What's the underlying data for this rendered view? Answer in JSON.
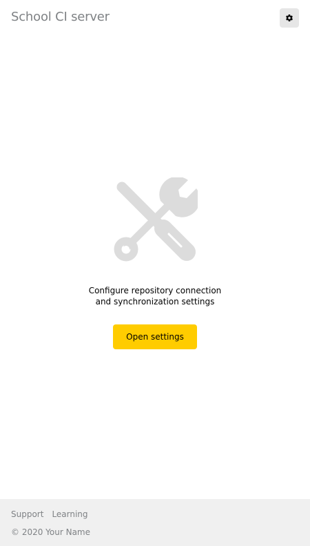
{
  "header": {
    "title": "School CI server",
    "settings_icon": "gear-icon"
  },
  "main": {
    "illustration_icon": "tools-icon",
    "message_line1": "Configure repository connection",
    "message_line2": "and synchronization settings",
    "button_label": "Open settings"
  },
  "footer": {
    "links": [
      {
        "label": "Support"
      },
      {
        "label": "Learning"
      }
    ],
    "copyright": "© 2020 Your Name"
  },
  "colors": {
    "accent": "#ffcc00",
    "muted_text": "#7f8285",
    "footer_bg": "#f0f0f0",
    "icon_gray": "#dcdcdc",
    "button_bg": "#e6e6e6"
  }
}
